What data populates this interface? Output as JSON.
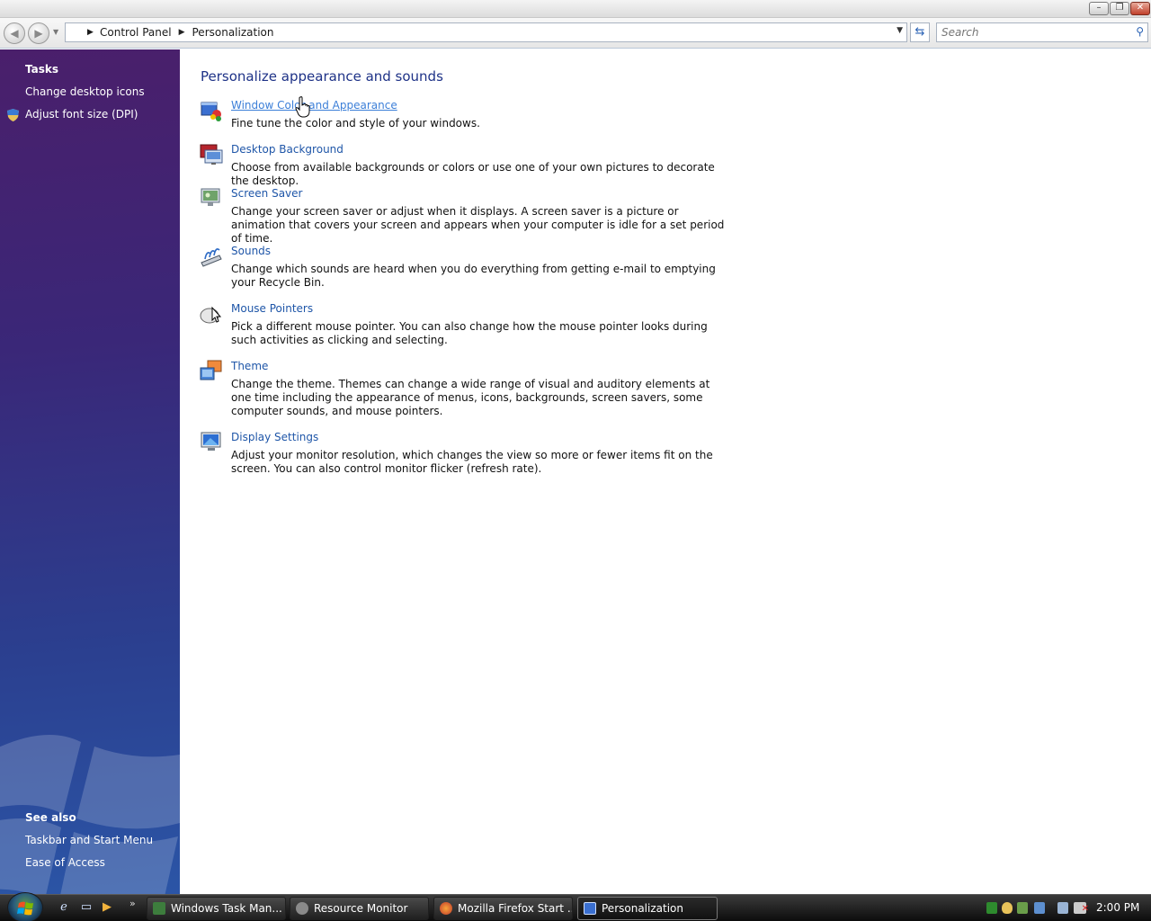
{
  "window": {
    "minimize_glyph": "–",
    "restore_glyph": "❐",
    "close_glyph": "✕"
  },
  "nav": {
    "back_icon": "back-arrow-icon",
    "forward_icon": "forward-arrow-icon",
    "breadcrumb": [
      "Control Panel",
      "Personalization"
    ],
    "search_placeholder": "Search"
  },
  "sidebar": {
    "tasks_heading": "Tasks",
    "tasks": [
      {
        "label": "Change desktop icons"
      },
      {
        "label": "Adjust font size (DPI)",
        "icon": "uac-shield-icon"
      }
    ],
    "see_also_heading": "See also",
    "see_also": [
      {
        "label": "Taskbar and Start Menu"
      },
      {
        "label": "Ease of Access"
      }
    ]
  },
  "main": {
    "title": "Personalize appearance and sounds",
    "items": [
      {
        "title": "Window Color and Appearance",
        "description": "Fine tune the color and style of your windows.",
        "icon": "window-color-icon"
      },
      {
        "title": "Desktop Background",
        "description": "Choose from available backgrounds or colors or use one of your own pictures to decorate the desktop.",
        "icon": "desktop-background-icon"
      },
      {
        "title": "Screen Saver",
        "description": "Change your screen saver or adjust when it displays. A screen saver is a picture or animation that covers your screen and appears when your computer is idle for a set period of time.",
        "icon": "screen-saver-icon"
      },
      {
        "title": "Sounds",
        "description": "Change which sounds are heard when you do everything from getting e-mail to emptying your Recycle Bin.",
        "icon": "sounds-icon"
      },
      {
        "title": "Mouse Pointers",
        "description": "Pick a different mouse pointer. You can also change how the mouse pointer looks during such activities as clicking and selecting.",
        "icon": "mouse-pointers-icon"
      },
      {
        "title": "Theme",
        "description": "Change the theme. Themes can change a wide range of visual and auditory elements at one time including the appearance of menus, icons, backgrounds, screen savers, some computer sounds, and mouse pointers.",
        "icon": "theme-icon"
      },
      {
        "title": "Display Settings",
        "description": "Adjust your monitor resolution, which changes the view so more or fewer items fit on the screen. You can also control monitor flicker (refresh rate).",
        "icon": "display-settings-icon"
      }
    ]
  },
  "taskbar": {
    "tasks": [
      {
        "label": "Windows Task Man...",
        "icon": "task-manager-icon"
      },
      {
        "label": "Resource Monitor",
        "icon": "resource-monitor-icon"
      },
      {
        "label": "Mozilla Firefox Start ...",
        "icon": "firefox-icon"
      },
      {
        "label": "Personalization",
        "icon": "personalization-icon",
        "active": true
      }
    ],
    "clock": "2:00 PM"
  }
}
